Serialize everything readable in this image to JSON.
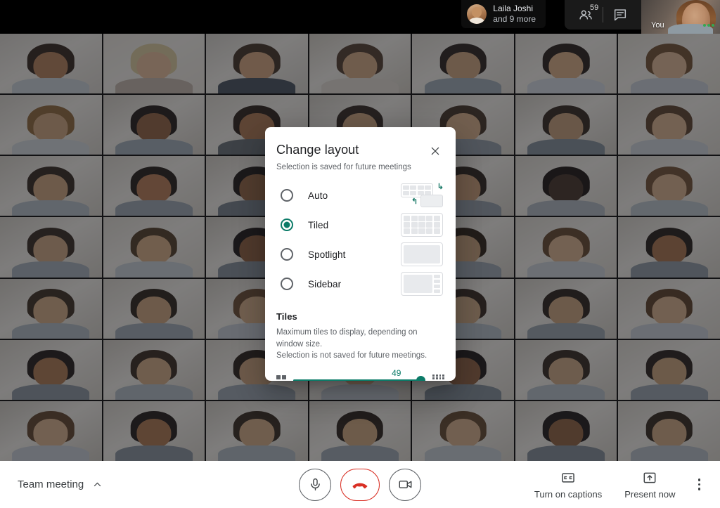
{
  "header": {
    "participant_chip": {
      "name": "Laila Joshi",
      "more": "and 9 more",
      "avatar_icon": "avatar"
    },
    "people_icon": "people-icon",
    "people_count": "59",
    "chat_icon": "chat-icon",
    "self_tile_label": "You"
  },
  "dialog": {
    "title": "Change layout",
    "subtitle": "Selection is saved for future meetings",
    "close_icon": "close-icon",
    "options": [
      {
        "label": "Auto",
        "selected": false,
        "thumb": "auto-thumb"
      },
      {
        "label": "Tiled",
        "selected": true,
        "thumb": "tiled-thumb"
      },
      {
        "label": "Spotlight",
        "selected": false,
        "thumb": "spotlight-thumb"
      },
      {
        "label": "Sidebar",
        "selected": false,
        "thumb": "sidebar-thumb"
      }
    ],
    "tiles_section": {
      "heading": "Tiles",
      "description_line1": "Maximum tiles to display, depending on window size.",
      "description_line2": "Selection is not saved for future meetings.",
      "slider_value": "49",
      "slider_min_icon": "small-grid-icon",
      "slider_max_icon": "large-grid-icon",
      "slider_percent": 100
    }
  },
  "bottom_bar": {
    "meeting_name": "Team meeting",
    "meeting_chevron_icon": "chevron-up-icon",
    "mic_icon": "microphone-icon",
    "hangup_icon": "end-call-icon",
    "camera_icon": "camera-icon",
    "captions": {
      "label": "Turn on captions",
      "icon": "closed-captions-icon"
    },
    "present": {
      "label": "Present now",
      "icon": "present-screen-icon"
    },
    "more_icon": "more-options-icon"
  },
  "colors": {
    "accent_teal": "#0b7b68",
    "hangup_red": "#d93025",
    "text_primary": "#202124",
    "text_secondary": "#5f6368"
  },
  "video_grid": {
    "columns": 7,
    "rows": 7,
    "tiles": [
      {
        "bg": "#d6d2cb",
        "skin": "#b07a52",
        "hair": "#2a1d16",
        "body": "#c6ced6"
      },
      {
        "bg": "#e6e1d8",
        "skin": "#e3b996",
        "hair": "#d8c79a",
        "body": "#bfb2a6"
      },
      {
        "bg": "#d0cdc6",
        "skin": "#d0a078",
        "hair": "#3a2a1e",
        "body": "#3f4a58"
      },
      {
        "bg": "#cfcabf",
        "skin": "#cfa47c",
        "hair": "#4a3526",
        "body": "#ddd8cf"
      },
      {
        "bg": "#d9d5cd",
        "skin": "#caa079",
        "hair": "#231a14",
        "body": "#9aa7b2"
      },
      {
        "bg": "#dcd8d0",
        "skin": "#d4a87e",
        "hair": "#1f1712",
        "body": "#cfd6dd"
      },
      {
        "bg": "#dedacf",
        "skin": "#dcb490",
        "hair": "#6b4a2c",
        "body": "#c5cdd4"
      },
      {
        "bg": "#d2cec6",
        "skin": "#cb9f78",
        "hair": "#8a6233",
        "body": "#ced5da"
      },
      {
        "bg": "#cdc8bf",
        "skin": "#8c5c3b",
        "hair": "#1a1310",
        "body": "#9ba8b4"
      },
      {
        "bg": "#d7d3ca",
        "skin": "#a8714a",
        "hair": "#241a13",
        "body": "#60686f"
      },
      {
        "bg": "#cac6bd",
        "skin": "#caa079",
        "hair": "#2c2119",
        "body": "#b9c2cb"
      },
      {
        "bg": "#d4d0c7",
        "skin": "#d6ab83",
        "hair": "#3b2a1d",
        "body": "#8d98a3"
      },
      {
        "bg": "#cbc7be",
        "skin": "#c29a74",
        "hair": "#2a1f17",
        "body": "#7d8a96"
      },
      {
        "bg": "#dad6cd",
        "skin": "#d8b08a",
        "hair": "#543a24",
        "body": "#c9d1d8"
      },
      {
        "bg": "#d1cdc4",
        "skin": "#caa079",
        "hair": "#2b2018",
        "body": "#b0bac4"
      },
      {
        "bg": "#d6d2c9",
        "skin": "#b4774f",
        "hair": "#1c1511",
        "body": "#97a3ae"
      },
      {
        "bg": "#cec9c0",
        "skin": "#8f5f3d",
        "hair": "#181210",
        "body": "#6f7b86"
      },
      {
        "bg": "#d3cfc6",
        "skin": "#d0a77f",
        "hair": "#36261a",
        "body": "#c1c9d1"
      },
      {
        "bg": "#cdc9c0",
        "skin": "#c79a72",
        "hair": "#241b14",
        "body": "#8f9aa5"
      },
      {
        "bg": "#d8d4cb",
        "skin": "#3c2b20",
        "hair": "#120d0a",
        "body": "#aab4bd"
      },
      {
        "bg": "#d5d1c8",
        "skin": "#d5ad87",
        "hair": "#6a4a2e",
        "body": "#b6c0c8"
      },
      {
        "bg": "#d0ccc3",
        "skin": "#caa27c",
        "hair": "#2e2219",
        "body": "#9fabb5"
      },
      {
        "bg": "#dbd7ce",
        "skin": "#d2a97f",
        "hair": "#4b351f",
        "body": "#c4ccd3"
      },
      {
        "bg": "#c9c5bc",
        "skin": "#8a5a38",
        "hair": "#161010",
        "body": "#7f8b96"
      },
      {
        "bg": "#d4d0c7",
        "skin": "#cda57e",
        "hair": "#2f2318",
        "body": "#b3bdc6"
      },
      {
        "bg": "#ccc8bf",
        "skin": "#c59d76",
        "hair": "#25190f",
        "body": "#97a2ad"
      },
      {
        "bg": "#d9d5cc",
        "skin": "#d7af89",
        "hair": "#5d4027",
        "body": "#c7cfd6"
      },
      {
        "bg": "#d2cec5",
        "skin": "#a46e46",
        "hair": "#1b1410",
        "body": "#8a95a0"
      },
      {
        "bg": "#cfcbc2",
        "skin": "#cfa77f",
        "hair": "#332619",
        "body": "#aab5be"
      },
      {
        "bg": "#d6d2c9",
        "skin": "#cba078",
        "hair": "#241b13",
        "body": "#9ba6b1"
      },
      {
        "bg": "#cbc7be",
        "skin": "#d3aa84",
        "hair": "#64452a",
        "body": "#c0c8d0"
      },
      {
        "bg": "#d8d4cb",
        "skin": "#8e5e3c",
        "hair": "#171110",
        "body": "#7b8792"
      },
      {
        "bg": "#d1cdc4",
        "skin": "#cca67f",
        "hair": "#2d2118",
        "body": "#b0bac3"
      },
      {
        "bg": "#cdc9c0",
        "skin": "#c8a079",
        "hair": "#221a12",
        "body": "#949fa9"
      },
      {
        "bg": "#dad6cd",
        "skin": "#d6ae88",
        "hair": "#55391f",
        "body": "#c5cdd5"
      },
      {
        "bg": "#d3cfc6",
        "skin": "#a97349",
        "hair": "#1a1311",
        "body": "#86919c"
      },
      {
        "bg": "#cec9c0",
        "skin": "#cfa77f",
        "hair": "#302318",
        "body": "#aeb8c1"
      },
      {
        "bg": "#d7d3ca",
        "skin": "#c9a178",
        "hair": "#231a13",
        "body": "#98a3ae"
      },
      {
        "bg": "#cac6bd",
        "skin": "#d4ac86",
        "hair": "#5f4228",
        "body": "#c2cad2"
      },
      {
        "bg": "#d5d1c8",
        "skin": "#8c5c3a",
        "hair": "#151010",
        "body": "#7d8994"
      },
      {
        "bg": "#d0ccc3",
        "skin": "#cba57e",
        "hair": "#2b2017",
        "body": "#b2bcc5"
      },
      {
        "bg": "#dbd7ce",
        "skin": "#c7a077",
        "hair": "#201812",
        "body": "#96a1ab"
      },
      {
        "bg": "#c9c5bc",
        "skin": "#d5ad87",
        "hair": "#5a3d25",
        "body": "#c3cbd3"
      },
      {
        "bg": "#d4d0c7",
        "skin": "#a97148",
        "hair": "#191211",
        "body": "#848f9a"
      },
      {
        "bg": "#ccc8bf",
        "skin": "#cea67e",
        "hair": "#2e2217",
        "body": "#acb6bf"
      },
      {
        "bg": "#d9d5cc",
        "skin": "#caa279",
        "hair": "#221a12",
        "body": "#99a4af"
      },
      {
        "bg": "#d2cec5",
        "skin": "#d3ab85",
        "hair": "#5c4027",
        "body": "#c1c9d1"
      },
      {
        "bg": "#cfcbc2",
        "skin": "#8b5b39",
        "hair": "#141010",
        "body": "#7c8893"
      },
      {
        "bg": "#d6d2c9",
        "skin": "#cca47d",
        "hair": "#2a1f16",
        "body": "#b1bbc4"
      }
    ]
  }
}
